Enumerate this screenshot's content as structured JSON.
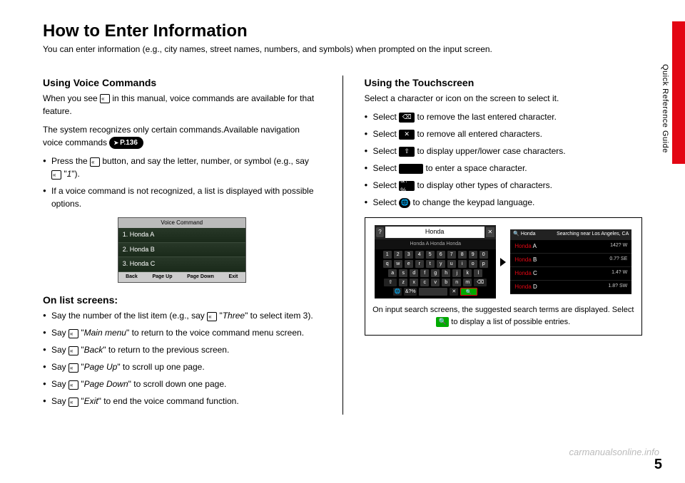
{
  "sideLabel": "Quick Reference Guide",
  "title": "How to Enter Information",
  "subtitle": "You can enter information (e.g., city names, street names, numbers, and symbols) when prompted on the input screen.",
  "left": {
    "h_voice": "Using Voice Commands",
    "voice_p1a": "When you see ",
    "voice_p1b": " in this manual, voice commands are available for that feature.",
    "voice_p2": "The system recognizes only certain commands.Available navigation voice commands ",
    "pageRef": "P.136",
    "voice_b1a": "Press the ",
    "voice_b1b": " button, and say the letter, number, or symbol (e.g., say ",
    "voice_b1c": " \"",
    "voice_b1d": "1",
    "voice_b1e": "\").",
    "voice_b2": "If a voice command is not recognized, a list is displayed with possible options.",
    "vc": {
      "title": "Voice Command",
      "rows": [
        "1. Honda A",
        "2. Honda B",
        "3. Honda C"
      ],
      "footer": [
        "Back",
        "Page Up",
        "Page Down",
        "Exit"
      ]
    },
    "h_list": "On list screens:",
    "list": {
      "b1a": "Say the number of the list item (e.g., say ",
      "b1b": " \"",
      "b1c": "Three",
      "b1d": "\" to select item 3).",
      "b2a": "Say ",
      "b2b": " \"",
      "b2c": "Main menu",
      "b2d": "\" to return to the voice command menu screen.",
      "b3a": "Say ",
      "b3b": " \"",
      "b3c": "Back",
      "b3d": "\" to return to the previous screen.",
      "b4a": "Say ",
      "b4b": " \"",
      "b4c": "Page Up",
      "b4d": "\" to scroll up one page.",
      "b5a": "Say ",
      "b5b": " \"",
      "b5c": "Page Down",
      "b5d": "\" to scroll down one page.",
      "b6a": "Say ",
      "b6b": " \"",
      "b6c": "Exit",
      "b6d": "\" to end the voice command function."
    }
  },
  "right": {
    "h_touch": "Using the Touchscreen",
    "touch_p1": "Select a character or icon on the screen to select it.",
    "b1a": "Select ",
    "b1b": " to remove the last entered character.",
    "b2a": "Select ",
    "b2b": " to remove all entered characters.",
    "b3a": "Select ",
    "b3b": " to display upper/lower case characters.",
    "b4a": "Select ",
    "b4b": " to enter a space character.",
    "b5a": "Select ",
    "b5b": " to display other types of characters.",
    "b6a": "Select ",
    "b6b": " to change the keypad language.",
    "icons": {
      "backspace": "⌫",
      "clearall": "✕",
      "shift": "⇧",
      "space": " ",
      "symbols": "&?%",
      "globe": "🌐",
      "search": "🔍"
    },
    "kbd": {
      "searchText": "Honda",
      "suggest": "Honda A    Honda    Honda",
      "row1": [
        "1",
        "2",
        "3",
        "4",
        "5",
        "6",
        "7",
        "8",
        "9",
        "0"
      ],
      "row2": [
        "q",
        "w",
        "e",
        "r",
        "t",
        "y",
        "u",
        "i",
        "o",
        "p"
      ],
      "row3": [
        "a",
        "s",
        "d",
        "f",
        "g",
        "h",
        "j",
        "k",
        "l"
      ],
      "row4_shift": "⇧",
      "row4": [
        "z",
        "x",
        "c",
        "v",
        "b",
        "n",
        "m"
      ],
      "row4_bksp": "⌫",
      "row5_globe": "🌐",
      "row5_sym": "&?%",
      "row5_search": "🔍"
    },
    "results": {
      "topLeft": "🔍 Honda",
      "topRight": "Searching near Los Angeles, CA",
      "rows": [
        {
          "hl": "Honda ",
          "rest": "A",
          "dist": "142? W"
        },
        {
          "hl": "Honda ",
          "rest": "B",
          "dist": "0.7? SE"
        },
        {
          "hl": "Honda ",
          "rest": "C",
          "dist": "1.4? W"
        },
        {
          "hl": "Honda ",
          "rest": "D",
          "dist": "1.8? SW"
        }
      ]
    },
    "caption1": "On input search screens, the suggested search terms are displayed. Select ",
    "caption2": " to display a list of possible entries."
  },
  "pageNumber": "5",
  "watermark": "carmanualsonline.info"
}
